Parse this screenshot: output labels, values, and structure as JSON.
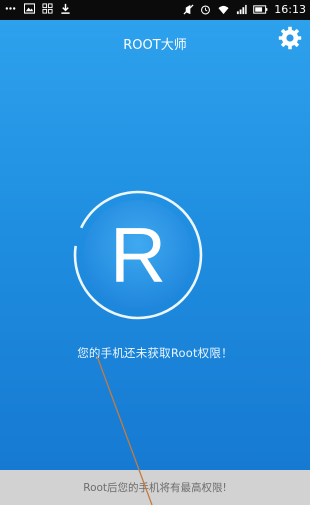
{
  "status_bar": {
    "time": "16:13",
    "icons_left": [
      "more-dots-icon",
      "image-icon",
      "app-grid-icon",
      "download-icon"
    ],
    "icons_right": [
      "mute-icon",
      "alarm-icon",
      "wifi-icon",
      "signal-icon",
      "battery-icon"
    ]
  },
  "header": {
    "title": "ROOT大师",
    "settings_icon": "gear-icon"
  },
  "main": {
    "logo_letter": "R",
    "status_message": "您的手机还未获取Root权限！"
  },
  "footer": {
    "hint": "Root后您的手机将有最高权限!"
  },
  "colors": {
    "background_top": "#2fa3ee",
    "background_bottom": "#1577d0",
    "circle_fill": "#2a8fe4",
    "footer_bg": "#d2d2d2",
    "annotation_line": "#c47b40"
  }
}
